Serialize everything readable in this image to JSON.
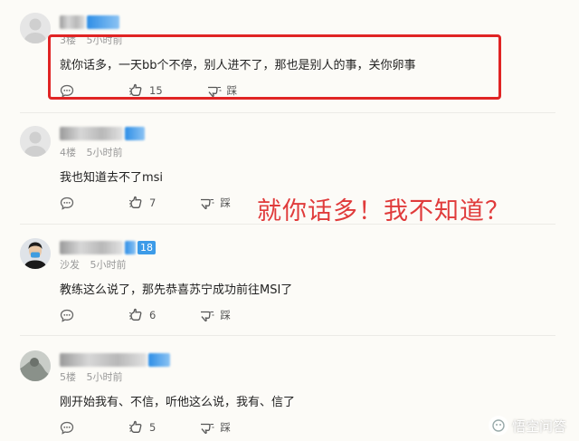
{
  "comments": [
    {
      "floor": "3楼",
      "time": "5小时前",
      "text": "就你话多，一天bb个不停，别人进不了，那也是别人的事，关你卵事",
      "likes": "15",
      "dislike_label": "踩"
    },
    {
      "floor": "4楼",
      "time": "5小时前",
      "text": "我也知道去不了msi",
      "likes": "7",
      "dislike_label": "踩"
    },
    {
      "floor": "沙发",
      "time": "5小时前",
      "level": "18",
      "text": "教练这么说了，那先恭喜苏宁成功前往MSI了",
      "likes": "6",
      "dislike_label": "踩"
    },
    {
      "floor": "5楼",
      "time": "5小时前",
      "text": "刚开始我有、不信，听他这么说，我有、信了",
      "likes": "5",
      "dislike_label": "踩"
    }
  ],
  "annotation": "就你话多！我不知道？",
  "watermark": "悟空问答",
  "colors": {
    "highlight_border": "#e02424",
    "annotation": "#e03b3b",
    "badge": "#3c9be8",
    "background": "#fcfbf7"
  },
  "icons": [
    "comment-icon",
    "like-icon",
    "dislike-icon"
  ]
}
